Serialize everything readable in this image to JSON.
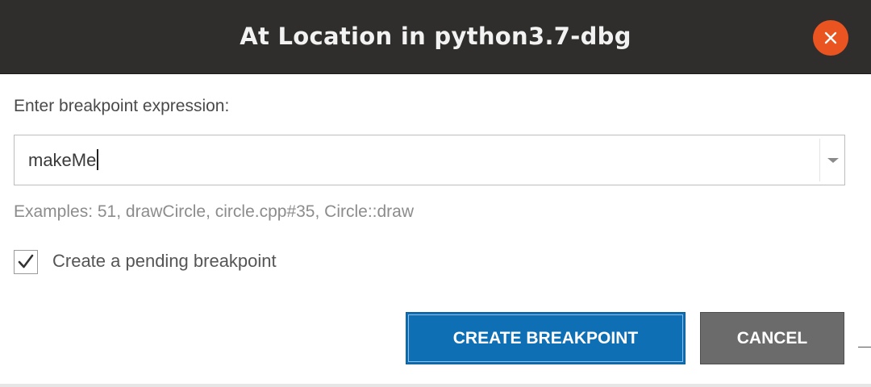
{
  "window": {
    "title": "At Location in python3.7-dbg",
    "close_icon": "close-icon",
    "accent_close": "#e95420",
    "titlebar_color": "#2f2e2c"
  },
  "form": {
    "prompt": "Enter breakpoint expression:",
    "expression_value": "makeMe",
    "dropdown_icon": "chevron-down-icon",
    "examples": "Examples: 51, drawCircle, circle.cpp#35, Circle::draw",
    "pending_checkbox": {
      "label": "Create a pending breakpoint",
      "checked": true,
      "icon": "check-icon"
    }
  },
  "actions": {
    "create_label": "CREATE BREAKPOINT",
    "create_color": "#0e6fb5",
    "cancel_label": "CANCEL",
    "cancel_color": "#6b6b6b"
  }
}
